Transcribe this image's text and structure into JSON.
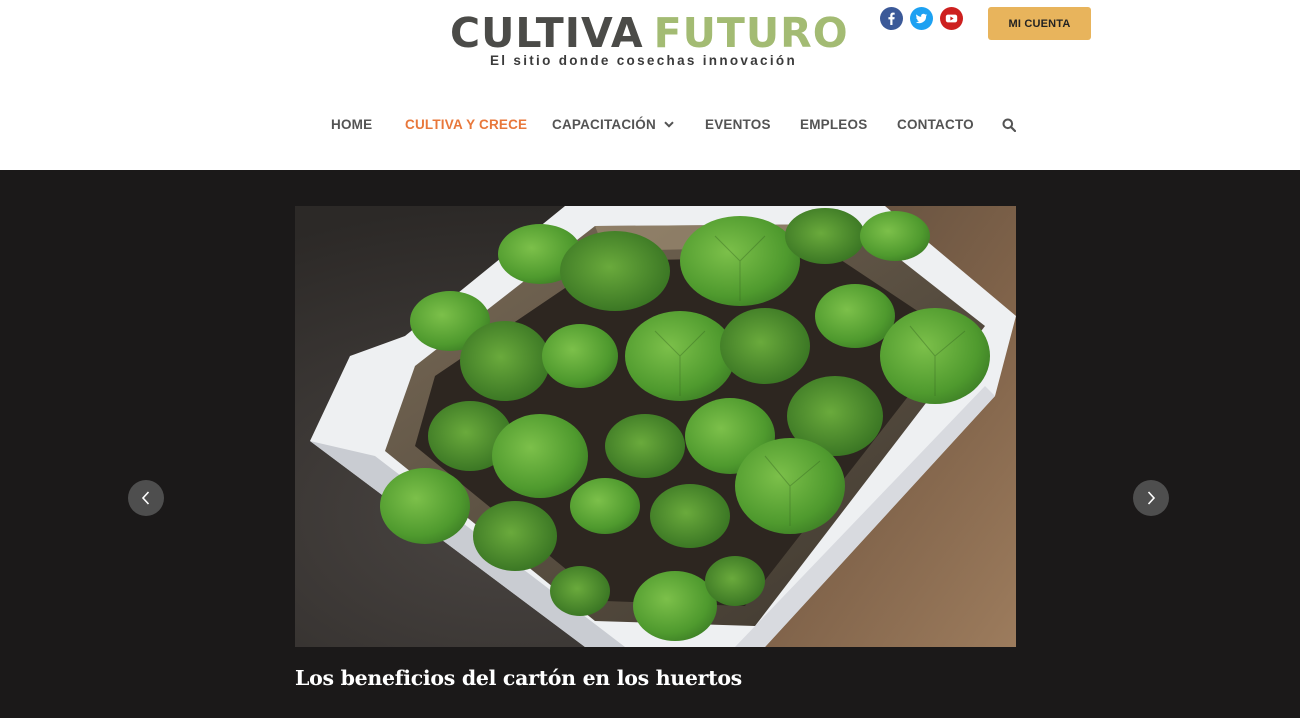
{
  "brand": {
    "title_part1": "CULTIVA",
    "title_part2": "FUTURO",
    "tagline": "El sitio donde cosechas innovación",
    "colors": {
      "dark": "#4b4b48",
      "green": "#a3bb73"
    }
  },
  "social": [
    {
      "icon": "facebook-icon",
      "color": "#3b5998"
    },
    {
      "icon": "twitter-icon",
      "color": "#1da1f2"
    },
    {
      "icon": "youtube-icon",
      "color": "#cd201f"
    }
  ],
  "account": {
    "label": "MI CUENTA",
    "color": "#e8b45c"
  },
  "nav": {
    "items": [
      {
        "label": "HOME",
        "active": false
      },
      {
        "label": "CULTIVA Y CRECE",
        "active": true
      },
      {
        "label": "CAPACITACIÓN",
        "active": false,
        "has_dropdown": true
      },
      {
        "label": "EVENTOS",
        "active": false
      },
      {
        "label": "EMPLEOS",
        "active": false
      },
      {
        "label": "CONTACTO",
        "active": false
      }
    ],
    "active_color": "#e8773a",
    "search_icon": "search-icon"
  },
  "hero": {
    "background": "#1b1919",
    "slide": {
      "image": "cardboard box planter with young seedlings",
      "title": "Los beneficios del cartón en los huertos",
      "excerpt": ""
    },
    "prev_icon": "chevron-left-icon",
    "next_icon": "chevron-right-icon"
  }
}
